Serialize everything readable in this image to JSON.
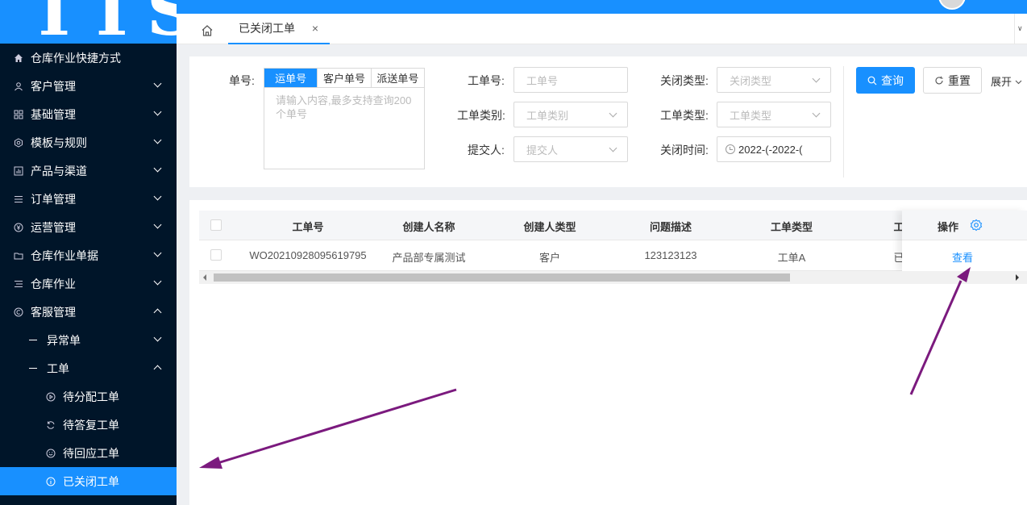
{
  "logo": {
    "text": "TTS"
  },
  "sidebar": {
    "items": [
      {
        "label": "仓库作业快捷方式",
        "icon": "home-icon"
      },
      {
        "label": "客户管理",
        "icon": "user-icon"
      },
      {
        "label": "基础管理",
        "icon": "grid-icon"
      },
      {
        "label": "模板与规则",
        "icon": "settings-icon"
      },
      {
        "label": "产品与渠道",
        "icon": "chart-icon"
      },
      {
        "label": "订单管理",
        "icon": "list-icon"
      },
      {
        "label": "运营管理",
        "icon": "yen-icon"
      },
      {
        "label": "仓库作业单据",
        "icon": "folder-icon"
      },
      {
        "label": "仓库作业",
        "icon": "list-icon"
      },
      {
        "label": "客服管理",
        "icon": "copyright-icon"
      }
    ],
    "sub_items": [
      {
        "label": "异常单"
      },
      {
        "label": "工单"
      }
    ],
    "leaf_items": [
      {
        "label": "待分配工单",
        "icon": "play-circle-icon"
      },
      {
        "label": "待答复工单",
        "icon": "sync-icon"
      },
      {
        "label": "待回应工单",
        "icon": "smile-icon"
      },
      {
        "label": "已关闭工单",
        "icon": "info-circle-icon"
      }
    ]
  },
  "tabs": {
    "active_label": "已关闭工单",
    "close": "×",
    "more": "∨"
  },
  "search": {
    "order_label": "单号:",
    "seg_options": [
      "运单号",
      "客户单号",
      "派送单号"
    ],
    "order_placeholder": "请输入内容,最多支持查询200个单号",
    "ticket_no_label": "工单号:",
    "ticket_no_placeholder": "工单号",
    "ticket_category_label": "工单类别:",
    "ticket_category_placeholder": "工单类别",
    "submitter_label": "提交人:",
    "submitter_placeholder": "提交人",
    "close_type_label": "关闭类型:",
    "close_type_placeholder": "关闭类型",
    "ticket_type_label": "工单类型:",
    "ticket_type_placeholder": "工单类型",
    "close_time_label": "关闭时间:",
    "close_time_start": "2022-(",
    "close_time_sep": "-",
    "close_time_end": "2022-(",
    "query_label": "查询",
    "reset_label": "重置",
    "expand_label": "展开"
  },
  "table": {
    "columns": [
      "工单号",
      "创建人名称",
      "创建人类型",
      "问题描述",
      "工单类型",
      "工"
    ],
    "action_header": "操作",
    "rows": [
      {
        "ticket_no": "WO20210928095619795",
        "creator": "产品部专属测试",
        "creator_type": "客户",
        "description": "123123123",
        "type": "工单A",
        "partial": "已",
        "action": "查看"
      }
    ]
  },
  "colors": {
    "primary": "#1890ff",
    "sidebar_bg": "#001529",
    "annotation": "#7b1a7e"
  }
}
